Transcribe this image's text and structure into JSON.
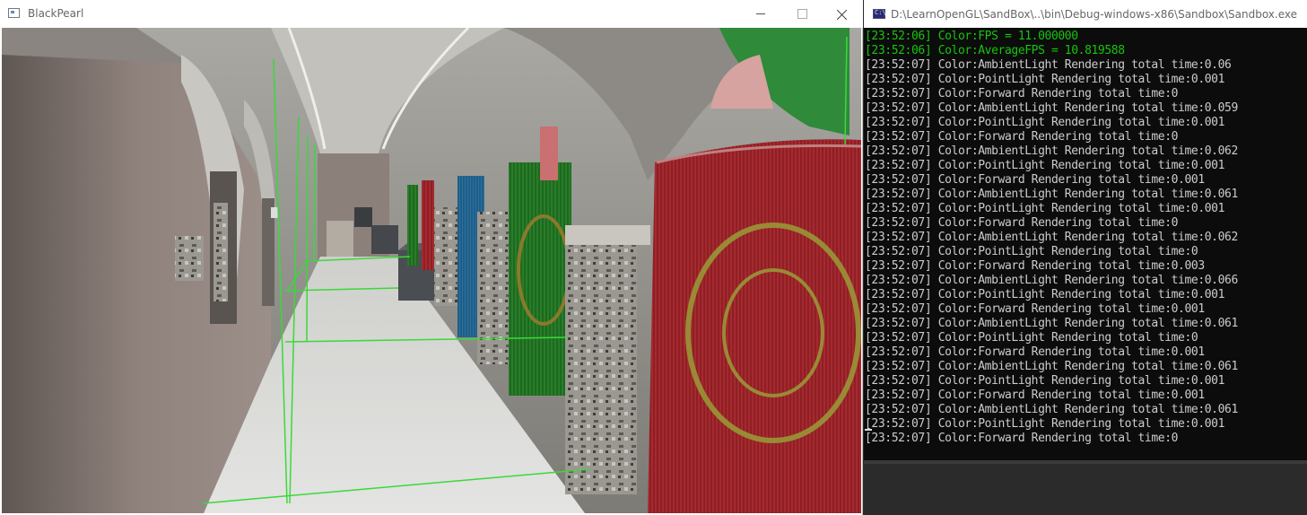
{
  "left_window": {
    "title": "BlackPearl",
    "icon": "app-window-icon",
    "controls": {
      "minimize": "minimize-icon",
      "maximize": "maximize-icon",
      "close": "close-icon"
    },
    "scene": "3d-render-viewport"
  },
  "right_window": {
    "title": "D:\\LearnOpenGL\\SandBox\\..\\bin\\Debug-windows-x86\\Sandbox\\Sandbox.exe",
    "icon": "console-icon",
    "lines": [
      {
        "text": "[23:52:06] Color:FPS = 11.000000",
        "color": "#16c60c"
      },
      {
        "text": "[23:52:06] Color:AverageFPS = 10.819588",
        "color": "#16c60c"
      },
      {
        "text": "[23:52:07] Color:AmbientLight Rendering total time:0.06",
        "color": "#cccccc"
      },
      {
        "text": "[23:52:07] Color:PointLight Rendering total time:0.001",
        "color": "#cccccc"
      },
      {
        "text": "[23:52:07] Color:Forward Rendering total time:0",
        "color": "#cccccc"
      },
      {
        "text": "[23:52:07] Color:AmbientLight Rendering total time:0.059",
        "color": "#cccccc"
      },
      {
        "text": "[23:52:07] Color:PointLight Rendering total time:0.001",
        "color": "#cccccc"
      },
      {
        "text": "[23:52:07] Color:Forward Rendering total time:0",
        "color": "#cccccc"
      },
      {
        "text": "[23:52:07] Color:AmbientLight Rendering total time:0.062",
        "color": "#cccccc"
      },
      {
        "text": "[23:52:07] Color:PointLight Rendering total time:0.001",
        "color": "#cccccc"
      },
      {
        "text": "[23:52:07] Color:Forward Rendering total time:0.001",
        "color": "#cccccc"
      },
      {
        "text": "[23:52:07] Color:AmbientLight Rendering total time:0.061",
        "color": "#cccccc"
      },
      {
        "text": "[23:52:07] Color:PointLight Rendering total time:0.001",
        "color": "#cccccc"
      },
      {
        "text": "[23:52:07] Color:Forward Rendering total time:0",
        "color": "#cccccc"
      },
      {
        "text": "[23:52:07] Color:AmbientLight Rendering total time:0.062",
        "color": "#cccccc"
      },
      {
        "text": "[23:52:07] Color:PointLight Rendering total time:0",
        "color": "#cccccc"
      },
      {
        "text": "[23:52:07] Color:Forward Rendering total time:0.003",
        "color": "#cccccc"
      },
      {
        "text": "[23:52:07] Color:AmbientLight Rendering total time:0.066",
        "color": "#cccccc"
      },
      {
        "text": "[23:52:07] Color:PointLight Rendering total time:0.001",
        "color": "#cccccc"
      },
      {
        "text": "[23:52:07] Color:Forward Rendering total time:0.001",
        "color": "#cccccc"
      },
      {
        "text": "[23:52:07] Color:AmbientLight Rendering total time:0.061",
        "color": "#cccccc"
      },
      {
        "text": "[23:52:07] Color:PointLight Rendering total time:0",
        "color": "#cccccc"
      },
      {
        "text": "[23:52:07] Color:Forward Rendering total time:0.001",
        "color": "#cccccc"
      },
      {
        "text": "[23:52:07] Color:AmbientLight Rendering total time:0.061",
        "color": "#cccccc"
      },
      {
        "text": "[23:52:07] Color:PointLight Rendering total time:0.001",
        "color": "#cccccc"
      },
      {
        "text": "[23:52:07] Color:Forward Rendering total time:0.001",
        "color": "#cccccc"
      },
      {
        "text": "[23:52:07] Color:AmbientLight Rendering total time:0.061",
        "color": "#cccccc"
      },
      {
        "text": "[23:52:07] Color:PointLight Rendering total time:0.001",
        "color": "#cccccc"
      },
      {
        "text": "[23:52:07] Color:Forward Rendering total time:0",
        "color": "#cccccc"
      }
    ]
  }
}
